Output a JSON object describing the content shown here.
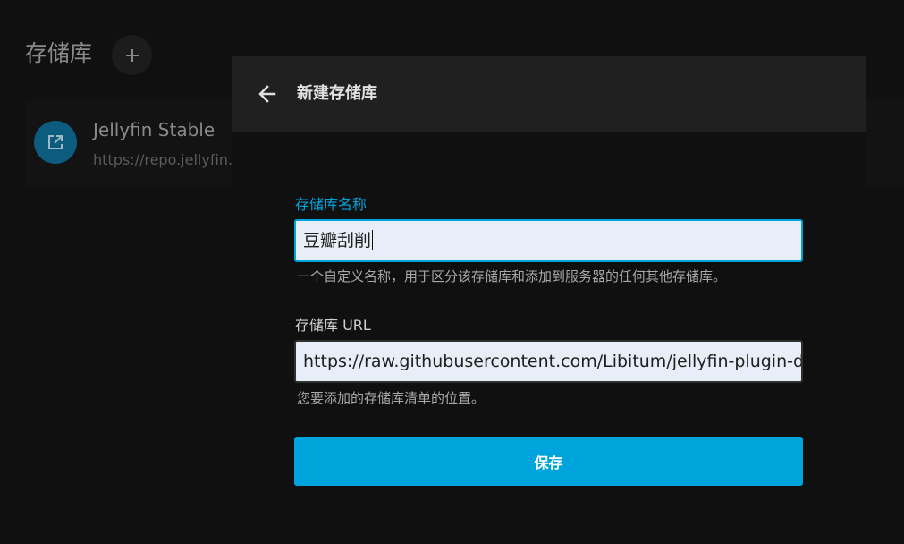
{
  "background": {
    "title": "存储库",
    "add_icon": "plus-icon",
    "repo_card": {
      "icon": "open-in-new-icon",
      "name": "Jellyfin Stable",
      "url": "https://repo.jellyfin.org/releases/plugin/manifest.json"
    }
  },
  "dialog": {
    "back_icon": "arrow-left-icon",
    "title": "新建存储库",
    "name_field": {
      "label": "存储库名称",
      "value": "豆瓣刮削",
      "description": "一个自定义名称，用于区分该存储库和添加到服务器的任何其他存储库。"
    },
    "url_field": {
      "label": "存储库 URL",
      "value": "https://raw.githubusercontent.com/Libitum/jellyfin-plugin-d",
      "description": "您要添加的存储库清单的位置。"
    },
    "save_label": "保存"
  },
  "colors": {
    "accent": "#00a4dc",
    "background": "#101010",
    "header": "#202020"
  }
}
